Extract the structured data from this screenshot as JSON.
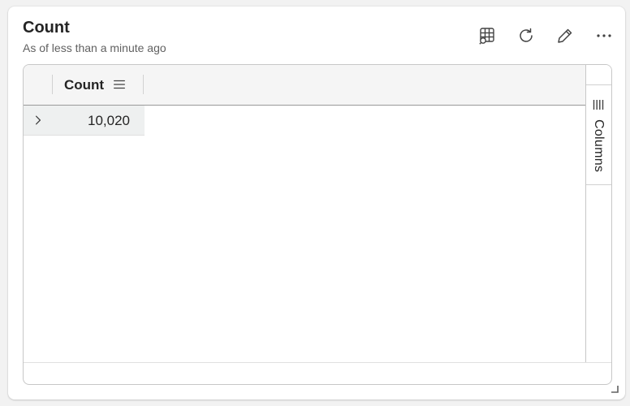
{
  "card": {
    "title": "Count",
    "subtitle": "As of less than a minute ago"
  },
  "toolbar": {
    "icons": [
      "table-search-icon",
      "refresh-icon",
      "edit-pencil-icon",
      "more-options-icon"
    ]
  },
  "grid": {
    "columns": [
      {
        "header": "Count"
      }
    ],
    "rows": [
      {
        "count": "10,020"
      }
    ]
  },
  "side_panel": {
    "columns_label": "Columns"
  },
  "colors": {
    "header_bg": "#f5f5f5",
    "row_bg": "#eef0f0",
    "border": "#c7c7c7",
    "text": "#242424",
    "subtext": "#616161"
  }
}
